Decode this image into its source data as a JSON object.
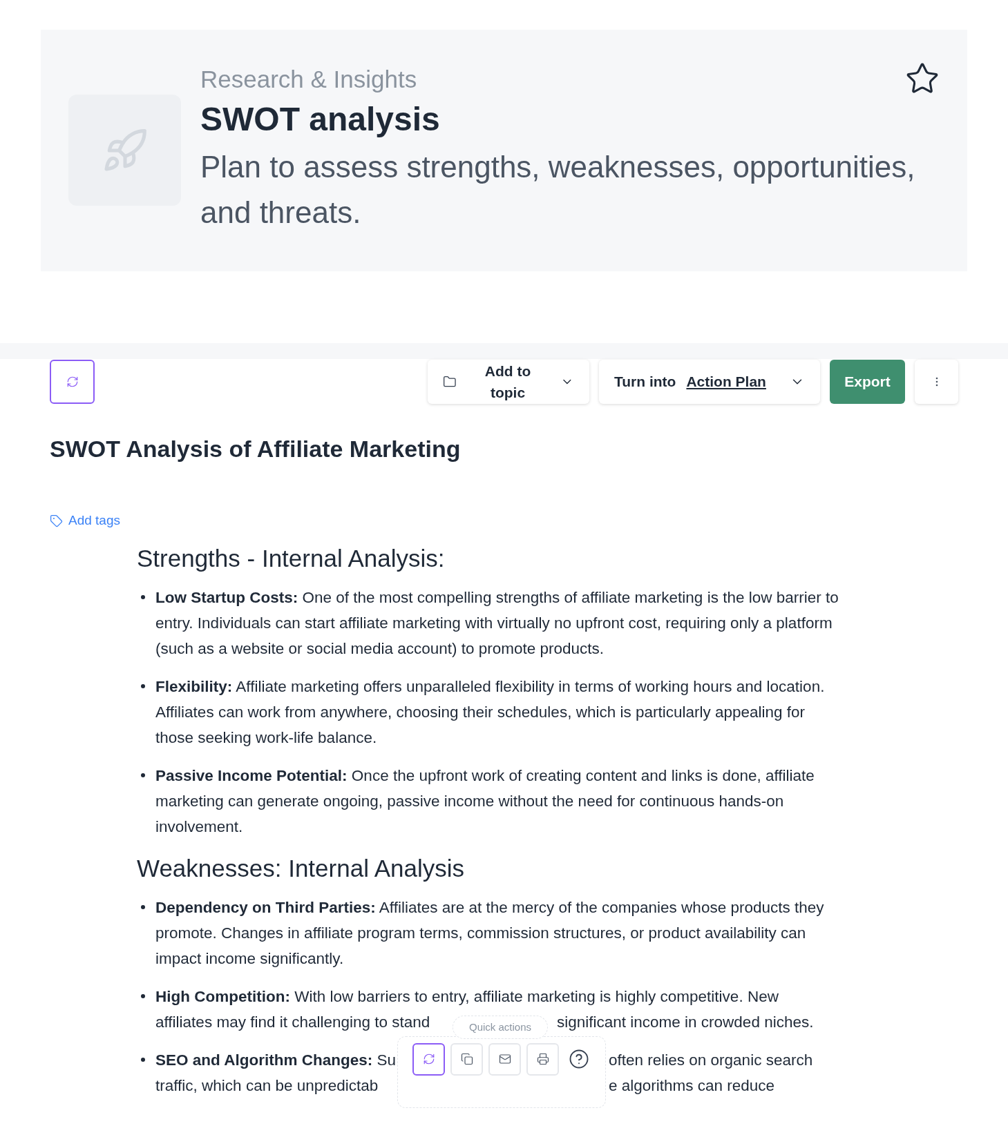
{
  "header": {
    "category": "Research & Insights",
    "title": "SWOT analysis",
    "description": "Plan to assess strengths, weaknesses, opportunities, and threats.",
    "starred": false
  },
  "toolbar": {
    "add_to_topic": "Add to topic",
    "turn_into_label": "Turn into",
    "turn_into_value": "Action Plan",
    "export": "Export"
  },
  "document": {
    "title": "SWOT Analysis of Affiliate Marketing",
    "add_tags": "Add tags",
    "sections": [
      {
        "heading": "Strengths - Internal Analysis:",
        "items": [
          {
            "kind": "full",
            "text": "**Low Startup Costs:** One of the most compelling strengths of affiliate marketing is the low barrier to entry. Individuals can start affiliate marketing with virtually no upfront cost, requiring only a platform (such as a website or social media account) to promote products."
          },
          {
            "kind": "full",
            "text": "**Flexibility:** Affiliate marketing offers unparalleled flexibility in terms of working hours and location. Affiliates can work from anywhere, choosing their schedules, which is particularly appealing for those seeking work-life balance."
          },
          {
            "kind": "full",
            "text": "**Passive Income Potential:** Once the upfront work of creating content and links is done, affiliate marketing can generate ongoing, passive income without the need for continuous hands-on involvement."
          }
        ]
      },
      {
        "heading": "Weaknesses: Internal Analysis",
        "items": [
          {
            "kind": "full",
            "text": "**Dependency on Third Parties:** Affiliates are at the mercy of the companies whose products they promote. Changes in affiliate program terms, commission structures, or product availability can impact income significantly."
          },
          {
            "kind": "covered",
            "lines": [
              {
                "text": "**High Competition:** With low barriers to entry, affiliate marketing is highly competitive. New"
              },
              {
                "text": "affiliates may find it challenging to stand",
                "after": "significant income in crowded niches."
              }
            ]
          },
          {
            "kind": "covered",
            "lines": [
              {
                "text": "**SEO and Algorithm Changes:** Su",
                "after": "often relies on organic search"
              },
              {
                "text": "traffic, which can be unpredictab",
                "after": "e algorithms can reduce"
              }
            ]
          }
        ]
      }
    ]
  },
  "quick_actions": {
    "label": "Quick actions",
    "buttons": [
      {
        "kind": "refresh",
        "selected": true
      },
      {
        "kind": "copy",
        "selected": false
      },
      {
        "kind": "mail",
        "selected": false
      },
      {
        "kind": "print",
        "selected": false
      },
      {
        "kind": "help",
        "selected": false
      }
    ]
  }
}
